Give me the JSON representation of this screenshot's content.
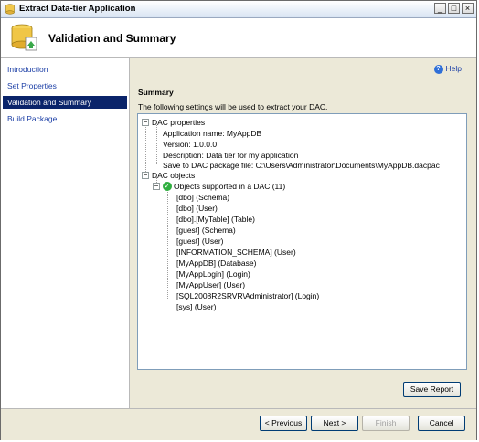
{
  "window": {
    "title": "Extract Data-tier Application",
    "buttons": {
      "minimize": "_",
      "maximize": "□",
      "close": "×"
    }
  },
  "header": {
    "title": "Validation and Summary"
  },
  "nav": {
    "items": [
      {
        "label": "Introduction",
        "selected": false
      },
      {
        "label": "Set Properties",
        "selected": false
      },
      {
        "label": "Validation and Summary",
        "selected": true
      },
      {
        "label": "Build Package",
        "selected": false
      }
    ]
  },
  "main": {
    "help_label": "Help",
    "summary_heading": "Summary",
    "summary_description": "The following settings will be used to extract your DAC.",
    "tree": {
      "dac_properties_label": "DAC properties",
      "properties": [
        "Application name: MyAppDB",
        "Version: 1.0.0.0",
        "Description: Data tier for my application",
        "Save to DAC package file: C:\\Users\\Administrator\\Documents\\MyAppDB.dacpac"
      ],
      "dac_objects_label": "DAC objects",
      "objects_supported_label": "Objects supported in a DAC (11)",
      "objects": [
        "[dbo] (Schema)",
        "[dbo] (User)",
        "[dbo].[MyTable] (Table)",
        "[guest] (Schema)",
        "[guest] (User)",
        "[INFORMATION_SCHEMA] (User)",
        "[MyAppDB] (Database)",
        "[MyAppLogin] (Login)",
        "[MyAppUser] (User)",
        "[SQL2008R2SRVR\\Administrator] (Login)",
        "[sys] (User)"
      ]
    },
    "save_report_label": "Save Report"
  },
  "footer": {
    "previous_label": "< Previous",
    "next_label": "Next >",
    "finish_label": "Finish",
    "cancel_label": "Cancel"
  }
}
